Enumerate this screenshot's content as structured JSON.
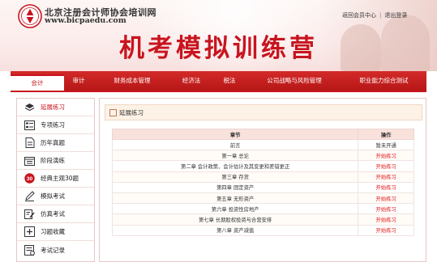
{
  "header": {
    "site_name": "北京注册会计师协会培训网",
    "site_url": "www.bicpaedu.com",
    "banner_title": "机考模拟训练营",
    "top_links": {
      "return_center": "返回会员中心",
      "separator": "|",
      "logout": "退出登录"
    }
  },
  "nav": {
    "items": [
      {
        "label": "会计"
      },
      {
        "label": "审计"
      },
      {
        "label": "财务成本管理"
      },
      {
        "label": "经济法"
      },
      {
        "label": "税法"
      },
      {
        "label": "公司战略与风险管理"
      },
      {
        "label": "职业能力综合测试"
      }
    ],
    "active": "会计"
  },
  "sidebar": {
    "items": [
      {
        "label": "延展练习",
        "icon": "layers-icon"
      },
      {
        "label": "专项练习",
        "icon": "list-icon"
      },
      {
        "label": "历年真题",
        "icon": "document-icon"
      },
      {
        "label": "阶段演练",
        "icon": "calendar-icon"
      },
      {
        "label": "经典主观30题",
        "icon": "thirty-badge-icon"
      },
      {
        "label": "模拟考试",
        "icon": "pencil-icon"
      },
      {
        "label": "仿真考试",
        "icon": "edit-note-icon"
      },
      {
        "label": "习题收藏",
        "icon": "bookmark-plus-icon"
      },
      {
        "label": "考试记录",
        "icon": "record-icon"
      }
    ]
  },
  "main": {
    "panel_title": "延展练习",
    "table": {
      "headers": {
        "chapter": "章节",
        "action": "操作"
      },
      "rows": [
        {
          "chapter": "前言",
          "action": "暂未开通"
        },
        {
          "chapter": "第一章  总论",
          "action": "开始练习"
        },
        {
          "chapter": "第二章  会计政策、会计估计及其变更和差错更正",
          "action": "开始练习"
        },
        {
          "chapter": "第三章  存货",
          "action": "开始练习"
        },
        {
          "chapter": "第四章  固定资产",
          "action": "开始练习"
        },
        {
          "chapter": "第五章  无形资产",
          "action": "开始练习"
        },
        {
          "chapter": "第六章  投资性房地产",
          "action": "开始练习"
        },
        {
          "chapter": "第七章  长期股权投资与合营安排",
          "action": "开始练习"
        },
        {
          "chapter": "第八章  资产减值",
          "action": "开始练习"
        }
      ]
    }
  },
  "colors": {
    "brand_red": "#c8141e",
    "link_red": "#e21d1d",
    "table_header": "#f9e1dc"
  }
}
